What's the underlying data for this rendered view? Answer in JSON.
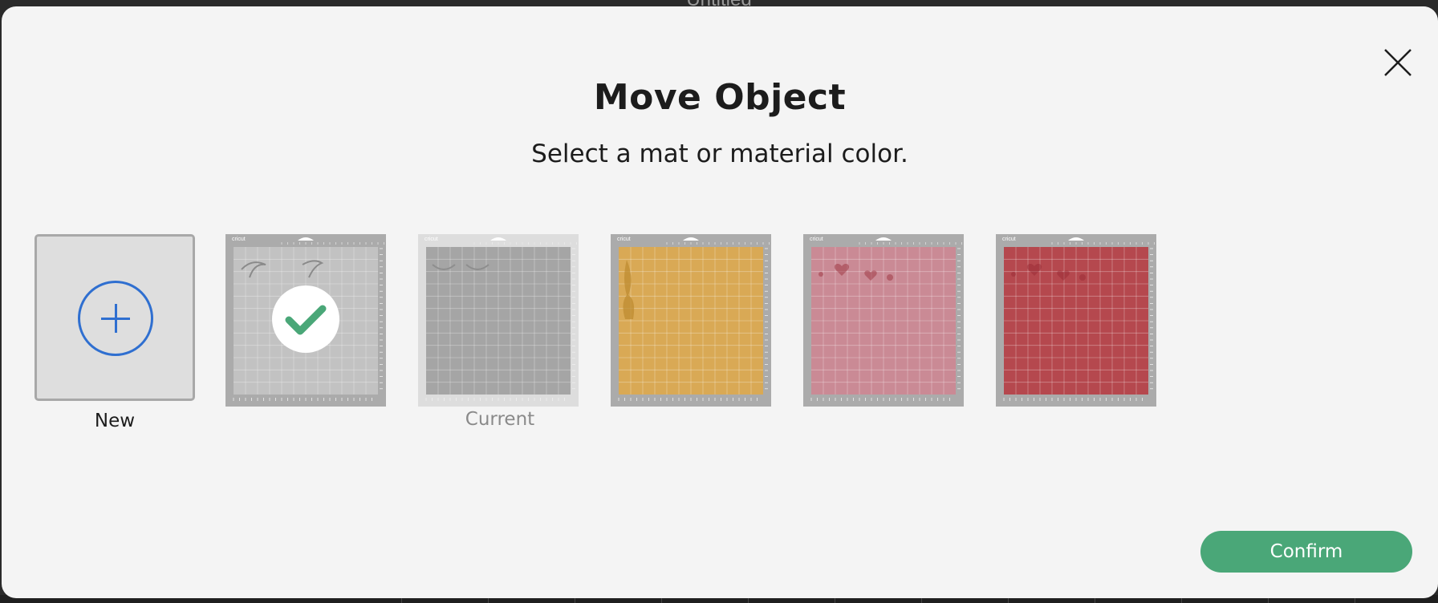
{
  "app": {
    "background_title": "Untitled"
  },
  "dialog": {
    "title": "Move Object",
    "subtitle": "Select a mat or material color.",
    "close_icon": "close-icon",
    "confirm_label": "Confirm"
  },
  "tiles": [
    {
      "kind": "new",
      "label": "New",
      "icon": "plus-circle-icon"
    },
    {
      "kind": "mat",
      "color": "#c2c2c2",
      "selected": true,
      "brand": "cricut",
      "content": "eyebrows"
    },
    {
      "kind": "mat",
      "color": "#a5a5a5",
      "selected": false,
      "brand": "cricut",
      "content": "eyelashes",
      "label": "Current",
      "current": true
    },
    {
      "kind": "mat",
      "color": "#d9a955",
      "selected": false,
      "brand": "cricut",
      "content": "unicorn-horn"
    },
    {
      "kind": "mat",
      "color": "#ca8a95",
      "selected": false,
      "brand": "cricut",
      "content": "hearts"
    },
    {
      "kind": "mat",
      "color": "#b5484e",
      "selected": false,
      "brand": "cricut",
      "content": "hearts"
    }
  ],
  "colors": {
    "accent": "#4aa778",
    "plus": "#2f6fd0"
  }
}
